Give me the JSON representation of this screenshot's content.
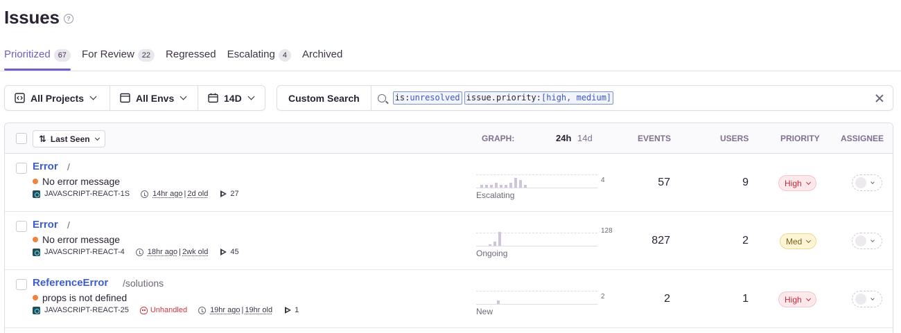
{
  "page": {
    "title": "Issues",
    "help_icon": "help-icon"
  },
  "tabs": [
    {
      "label": "Prioritized",
      "count": "67",
      "active": true
    },
    {
      "label": "For Review",
      "count": "22"
    },
    {
      "label": "Regressed",
      "count": ""
    },
    {
      "label": "Escalating",
      "count": "4"
    },
    {
      "label": "Archived",
      "count": ""
    }
  ],
  "filters": {
    "projects": "All Projects",
    "envs": "All Envs",
    "period": "14D"
  },
  "search": {
    "custom_label": "Custom Search",
    "token1_key": "is:",
    "token1_value": "unresolved",
    "token2_key": "issue.priority:",
    "token2_value": "[high, medium]"
  },
  "table_header": {
    "sort_label": "Last Seen",
    "graph": "GRAPH:",
    "graph_24h": "24h",
    "graph_14d": "14d",
    "events": "EVENTS",
    "users": "USERS",
    "priority": "PRIORITY",
    "assignee": "ASSIGNEE"
  },
  "issues": [
    {
      "title": "Error",
      "location": "/",
      "message": "No error message",
      "project": "JAVASCRIPT-REACT-1S",
      "unhandled": "",
      "last_seen": "14hr ago",
      "age": "2d old",
      "replays": "27",
      "graph_max": "4",
      "graph_label": "Escalating",
      "events": "57",
      "users": "9",
      "priority": "High",
      "bars": [
        1,
        1,
        1,
        2,
        1,
        1,
        2,
        4,
        3,
        1
      ]
    },
    {
      "title": "Error",
      "location": "/",
      "message": "No error message",
      "project": "JAVASCRIPT-REACT-4",
      "unhandled": "",
      "last_seen": "18hr ago",
      "age": "2wk old",
      "replays": "45",
      "graph_max": "128",
      "graph_label": "Ongoing",
      "events": "827",
      "users": "2",
      "priority": "Med",
      "bars": [
        10,
        40,
        128
      ]
    },
    {
      "title": "ReferenceError",
      "location": "/solutions",
      "message": "props is not defined",
      "project": "JAVASCRIPT-REACT-25",
      "unhandled": "Unhandled",
      "last_seen": "19hr ago",
      "age": "19hr old",
      "replays": "1",
      "graph_max": "2",
      "graph_label": "New",
      "events": "2",
      "users": "1",
      "priority": "High",
      "bars": [
        2
      ]
    }
  ]
}
